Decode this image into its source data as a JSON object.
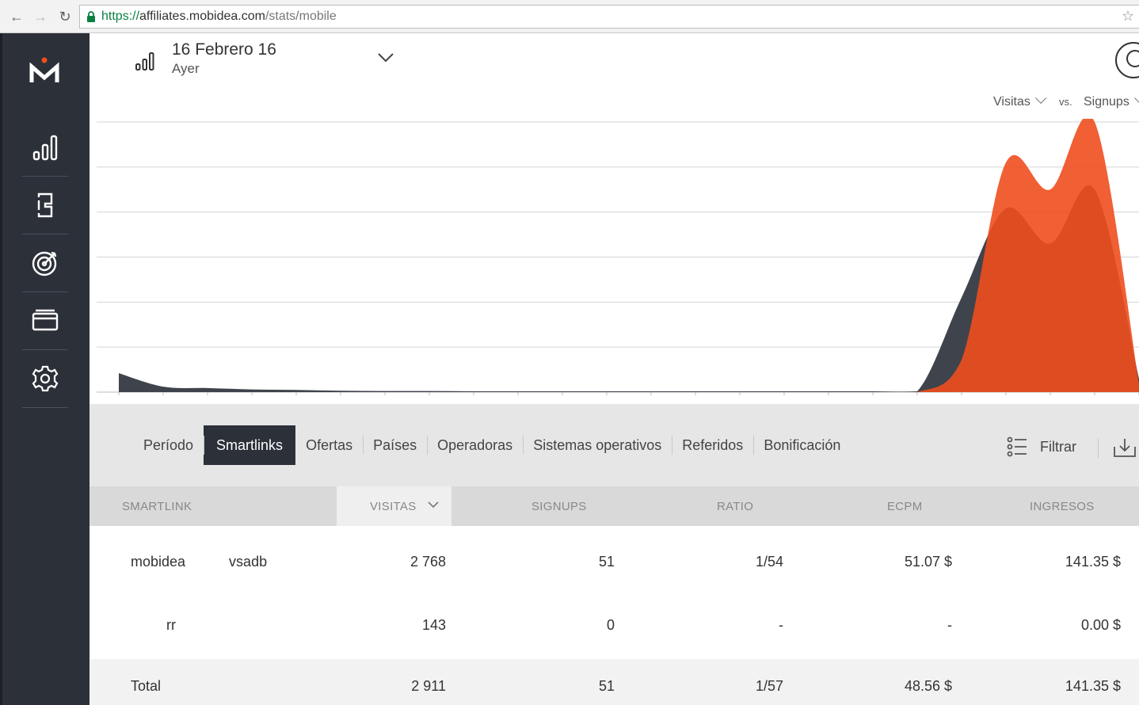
{
  "browser": {
    "url_scheme": "https://",
    "url_host": "affiliates.mobidea.com",
    "url_path": "/stats/mobile"
  },
  "sidebar": {
    "logo": "M",
    "items": [
      {
        "icon": "stats-bars-icon"
      },
      {
        "icon": "smartlink-icon"
      },
      {
        "icon": "target-icon"
      },
      {
        "icon": "credit-card-icon"
      },
      {
        "icon": "settings-gear-icon"
      }
    ]
  },
  "header": {
    "date": "16 Febrero 16",
    "period": "Ayer"
  },
  "metrics": {
    "primary": "Visitas",
    "vs": "vs.",
    "secondary": "Signups"
  },
  "chart_data": {
    "type": "area",
    "x": [
      0,
      1,
      2,
      3,
      4,
      5,
      6,
      7,
      8,
      9,
      10,
      11,
      12,
      13,
      14,
      15,
      16,
      17,
      18,
      19,
      20,
      21,
      22,
      23
    ],
    "series": [
      {
        "name": "Visitas",
        "color": "#3f434c",
        "values": [
          0.07,
          0.02,
          0.015,
          0.01,
          0.008,
          0.005,
          0.004,
          0.004,
          0.003,
          0.003,
          0.003,
          0.003,
          0.003,
          0.003,
          0.003,
          0.003,
          0.003,
          0.003,
          0.003,
          0.35,
          0.68,
          0.55,
          0.75,
          0.05
        ]
      },
      {
        "name": "Signups",
        "color": "#ef4e1e",
        "values": [
          0,
          0,
          0,
          0,
          0,
          0,
          0,
          0,
          0,
          0,
          0,
          0,
          0,
          0,
          0,
          0,
          0,
          0,
          0,
          0.12,
          0.85,
          0.75,
          1.0,
          0.03
        ]
      }
    ],
    "ylim": [
      0,
      1
    ],
    "grid": true
  },
  "tabs": [
    "Período",
    "Smartlinks",
    "Ofertas",
    "Países",
    "Operadoras",
    "Sistemas operativos",
    "Referidos",
    "Bonificación"
  ],
  "active_tab": "Smartlinks",
  "filter_label": "Filtrar",
  "table": {
    "columns": [
      "SMARTLINK",
      "VISITAS",
      "SIGNUPS",
      "RATIO",
      "ECPM",
      "INGRESOS"
    ],
    "rows": [
      [
        "mobidea           vsadb",
        "2 768",
        "51",
        "1/54",
        "51.07 $",
        "141.35 $"
      ],
      [
        "rr",
        "143",
        "0",
        "-",
        "-",
        "0.00 $"
      ]
    ],
    "total": [
      "Total",
      "2 911",
      "51",
      "1/57",
      "48.56 $",
      "141.35 $"
    ]
  }
}
